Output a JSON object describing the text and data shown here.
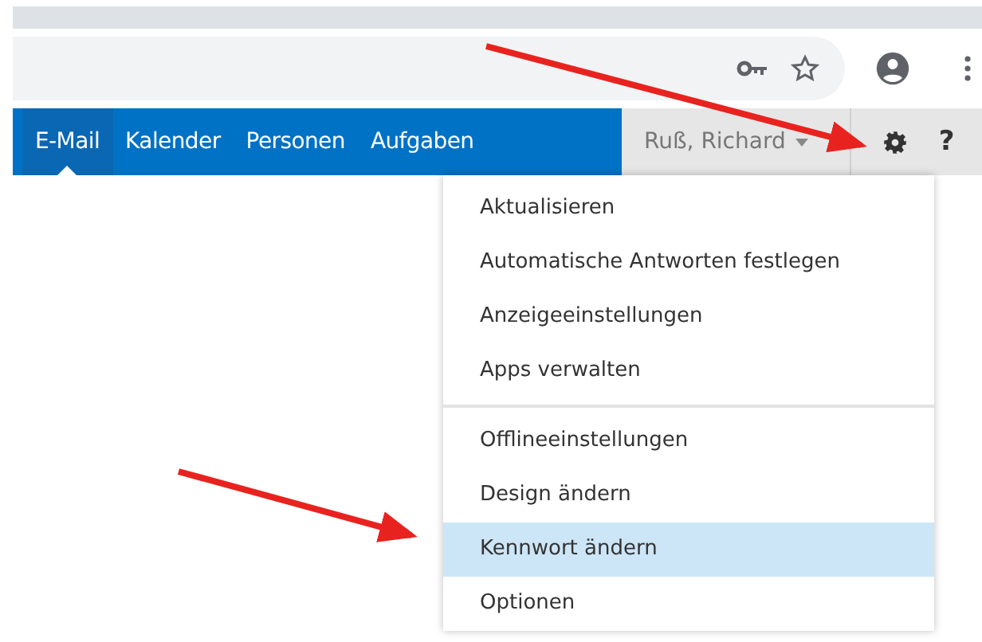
{
  "nav": {
    "tabs": [
      {
        "label": "E-Mail",
        "selected": true
      },
      {
        "label": "Kalender",
        "selected": false
      },
      {
        "label": "Personen",
        "selected": false
      },
      {
        "label": "Aufgaben",
        "selected": false
      }
    ],
    "user": "Ruß, Richard",
    "help": "?"
  },
  "menu": {
    "sections": [
      {
        "items": [
          {
            "label": "Aktualisieren",
            "selected": false
          },
          {
            "label": "Automatische Antworten festlegen",
            "selected": false
          },
          {
            "label": "Anzeigeeinstellungen",
            "selected": false
          },
          {
            "label": "Apps verwalten",
            "selected": false
          }
        ]
      },
      {
        "items": [
          {
            "label": "Offlineeinstellungen",
            "selected": false
          },
          {
            "label": "Design ändern",
            "selected": false
          },
          {
            "label": "Kennwort ändern",
            "selected": true
          },
          {
            "label": "Optionen",
            "selected": false
          }
        ]
      }
    ]
  }
}
